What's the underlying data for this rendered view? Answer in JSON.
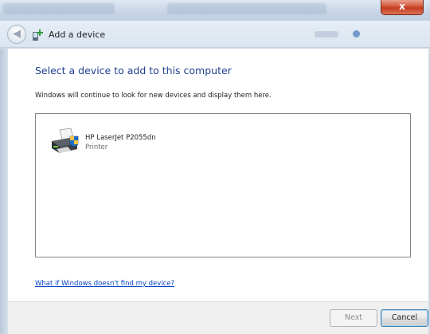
{
  "window": {
    "close_label": "x"
  },
  "nav": {
    "back_icon": "back-arrow-icon",
    "title_icon": "add-device-icon",
    "title": "Add a device"
  },
  "main": {
    "heading": "Select a device to add to this computer",
    "subtext": "Windows will continue to look for new devices and display them here.",
    "devices": [
      {
        "name": "HP LaserJet P2055dn",
        "type": "Printer",
        "icon": "printer-icon"
      }
    ],
    "help_link": "What if Windows doesn't find my device?"
  },
  "footer": {
    "next_label": "Next",
    "next_enabled": false,
    "cancel_label": "Cancel"
  },
  "colors": {
    "heading": "#1f3f8f",
    "link": "#0645c8",
    "close_button": "#c63a1e"
  }
}
